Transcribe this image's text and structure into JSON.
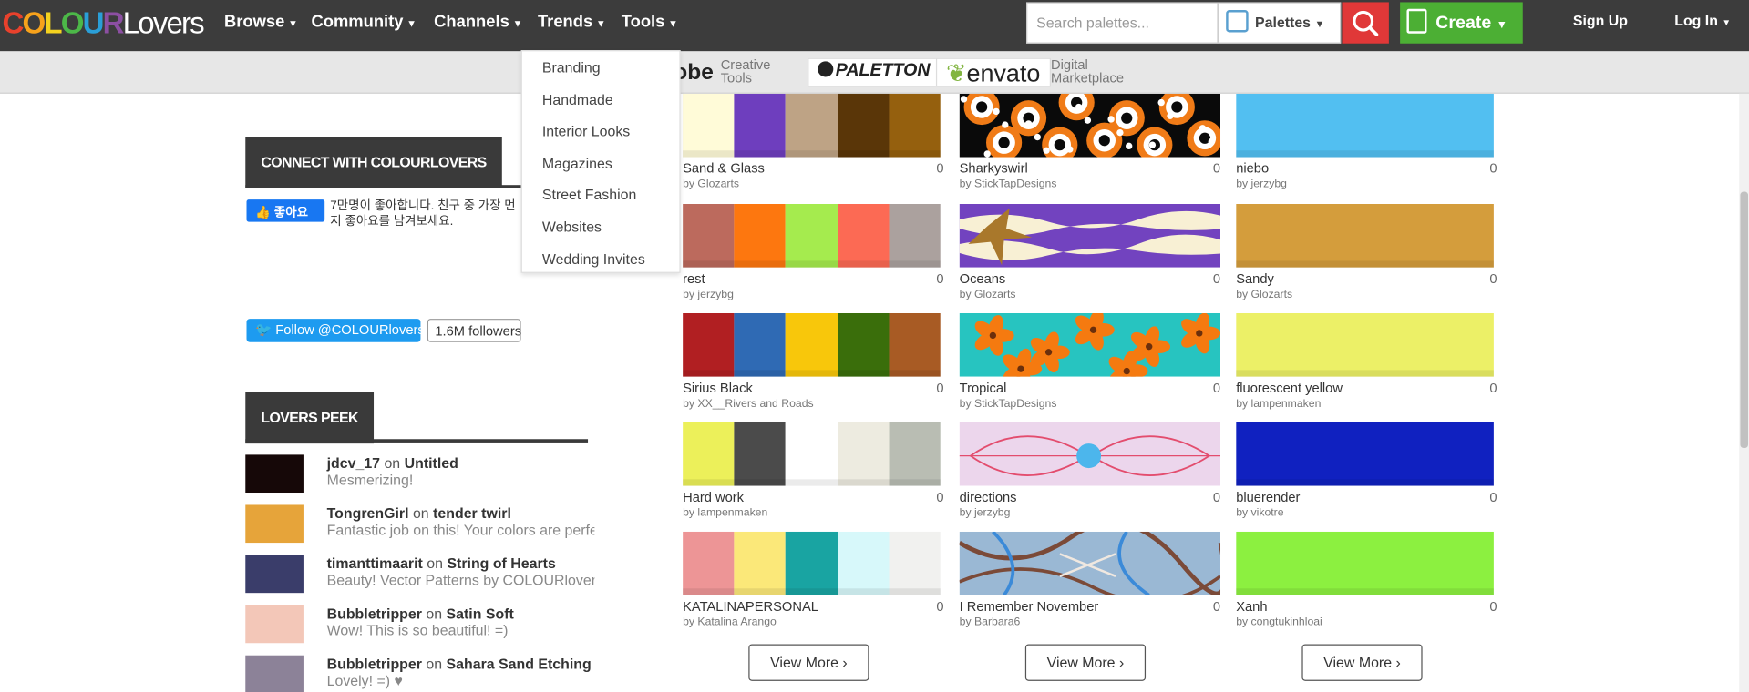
{
  "nav": {
    "logo": {
      "colour": "COLOUR",
      "lovers": "Lovers"
    },
    "items": [
      "Browse",
      "Community",
      "Channels",
      "Trends",
      "Tools"
    ],
    "search_placeholder": "Search palettes...",
    "search_type": "Palettes",
    "create": "Create",
    "sign_up": "Sign Up",
    "log_in": "Log In"
  },
  "sponsors": [
    {
      "name": "obe",
      "tag1": "Creative",
      "tag2": "Tools"
    },
    {
      "name": "PALETTON"
    },
    {
      "name": "envato",
      "tag1": "Digital",
      "tag2": "Marketplace"
    }
  ],
  "trends_menu": [
    "Branding",
    "Handmade",
    "Interior Looks",
    "Magazines",
    "Street Fashion",
    "Websites",
    "Wedding Invites"
  ],
  "connect": {
    "title": "CONNECT WITH COLOURLOVERS",
    "fb_like": "👍 좋아요",
    "fb_text": "7만명이 좋아합니다. 친구 중 가장 먼저 좋아요를 남겨보세요.",
    "twitter_follow": "Follow @COLOURlovers",
    "twitter_followers": "1.6M followers"
  },
  "peek": {
    "title": "LOVERS PEEK",
    "items": [
      {
        "user": "jdcv_17",
        "on": "on",
        "target": "Untitled",
        "comment": "Mesmerizing!",
        "thumb": "#160808"
      },
      {
        "user": "TongrenGirl",
        "on": "on",
        "target": "tender twirl",
        "comment": "Fantastic job on this! Your colors are perfect!",
        "thumb": "#e6a43a"
      },
      {
        "user": "timanttimaarit",
        "on": "on",
        "target": "String of Hearts",
        "comment": "Beauty! Vector Patterns by COLOURlovers",
        "thumb": "#3a3d6a"
      },
      {
        "user": "Bubbletripper",
        "on": "on",
        "target": "Satin Soft",
        "comment": "Wow! This is so beautiful! =)",
        "thumb": "#f3c7b8"
      },
      {
        "user": "Bubbletripper",
        "on": "on",
        "target": "Sahara Sand Etching",
        "comment": "Lovely! =) ♥",
        "thumb": "#8c8298"
      }
    ]
  },
  "palettes": [
    [
      {
        "name": "Sand & Glass",
        "by": "by Glozarts",
        "count": "0",
        "colors": [
          "#fffbd8",
          "#6e3ebe",
          "#bea385",
          "#5a3608",
          "#95600e"
        ]
      },
      {
        "name": "rest",
        "by": "by jerzybg",
        "count": "0",
        "colors": [
          "#bc6a5d",
          "#fd770f",
          "#a5eb4e",
          "#fc6a54",
          "#aba19e"
        ]
      },
      {
        "name": "Sirius Black",
        "by": "by XX__Rivers and Roads",
        "count": "0",
        "colors": [
          "#b11f22",
          "#2f6ab4",
          "#f8c70b",
          "#3a6e0b",
          "#a85b24"
        ]
      },
      {
        "name": "Hard work",
        "by": "by lampenmaken",
        "count": "0",
        "colors": [
          "#ecf05a",
          "#4b4b4b",
          "#ffffff",
          "#edebe0",
          "#b9bdb3"
        ]
      },
      {
        "name": "KATALINAPERSONAL",
        "by": "by Katalina Arango",
        "count": "0",
        "colors": [
          "#ed9596",
          "#fbe879",
          "#19a4a2",
          "#d7f8fa",
          "#f1f1ef"
        ]
      }
    ],
    [
      {
        "name": "Sharkyswirl",
        "by": "by StickTapDesigns",
        "count": "0",
        "pattern": "sharky"
      },
      {
        "name": "Oceans",
        "by": "by Glozarts",
        "count": "0",
        "pattern": "oceans"
      },
      {
        "name": "Tropical",
        "by": "by StickTapDesigns",
        "count": "0",
        "pattern": "tropical"
      },
      {
        "name": "directions",
        "by": "by jerzybg",
        "count": "0",
        "pattern": "directions"
      },
      {
        "name": "I Remember November",
        "by": "by Barbara6",
        "count": "0",
        "pattern": "november"
      }
    ],
    [
      {
        "name": "niebo",
        "by": "by jerzybg",
        "count": "0",
        "colors": [
          "#52bff1"
        ]
      },
      {
        "name": "Sandy",
        "by": "by Glozarts",
        "count": "0",
        "colors": [
          "#d49d3c"
        ]
      },
      {
        "name": "fluorescent yellow",
        "by": "by lampenmaken",
        "count": "0",
        "colors": [
          "#ecf067"
        ]
      },
      {
        "name": "bluerender",
        "by": "by vikotre",
        "count": "0",
        "colors": [
          "#1021c0"
        ]
      },
      {
        "name": "Xanh",
        "by": "by congtukinhloai",
        "count": "0",
        "colors": [
          "#8cf040"
        ]
      }
    ]
  ],
  "view_more": "View More ›"
}
